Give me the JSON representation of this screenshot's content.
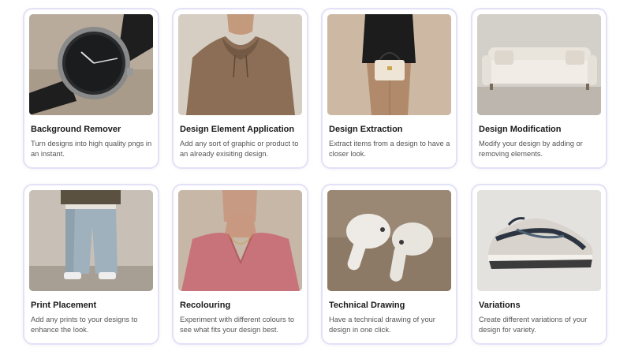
{
  "cards": [
    {
      "title": "Background Remover",
      "description": "Turn designs into high quality pngs in an instant.",
      "icon": "watch-photo"
    },
    {
      "title": "Design Element Application",
      "description": "Add any sort of graphic or product to an already exisiting design.",
      "icon": "hoodie-photo"
    },
    {
      "title": "Design Extraction",
      "description": "Extract items from a design to have a closer look.",
      "icon": "handbag-photo"
    },
    {
      "title": "Design Modification",
      "description": "Modify your design by adding or removing elements.",
      "icon": "sofa-photo"
    },
    {
      "title": "Print Placement",
      "description": "Add any prints to your designs to enhance the look.",
      "icon": "jeans-photo"
    },
    {
      "title": "Recolouring",
      "description": "Experiment with different colours to see what fits your design best.",
      "icon": "satin-top-photo"
    },
    {
      "title": "Technical Drawing",
      "description": "Have a technical drawing of your design in one click.",
      "icon": "earbuds-photo"
    },
    {
      "title": "Variations",
      "description": "Create different variations of your design for variety.",
      "icon": "sneaker-photo"
    }
  ],
  "colors": {
    "card_border": "#e3e1f6",
    "title": "#1a1a1a",
    "description": "#555555"
  }
}
